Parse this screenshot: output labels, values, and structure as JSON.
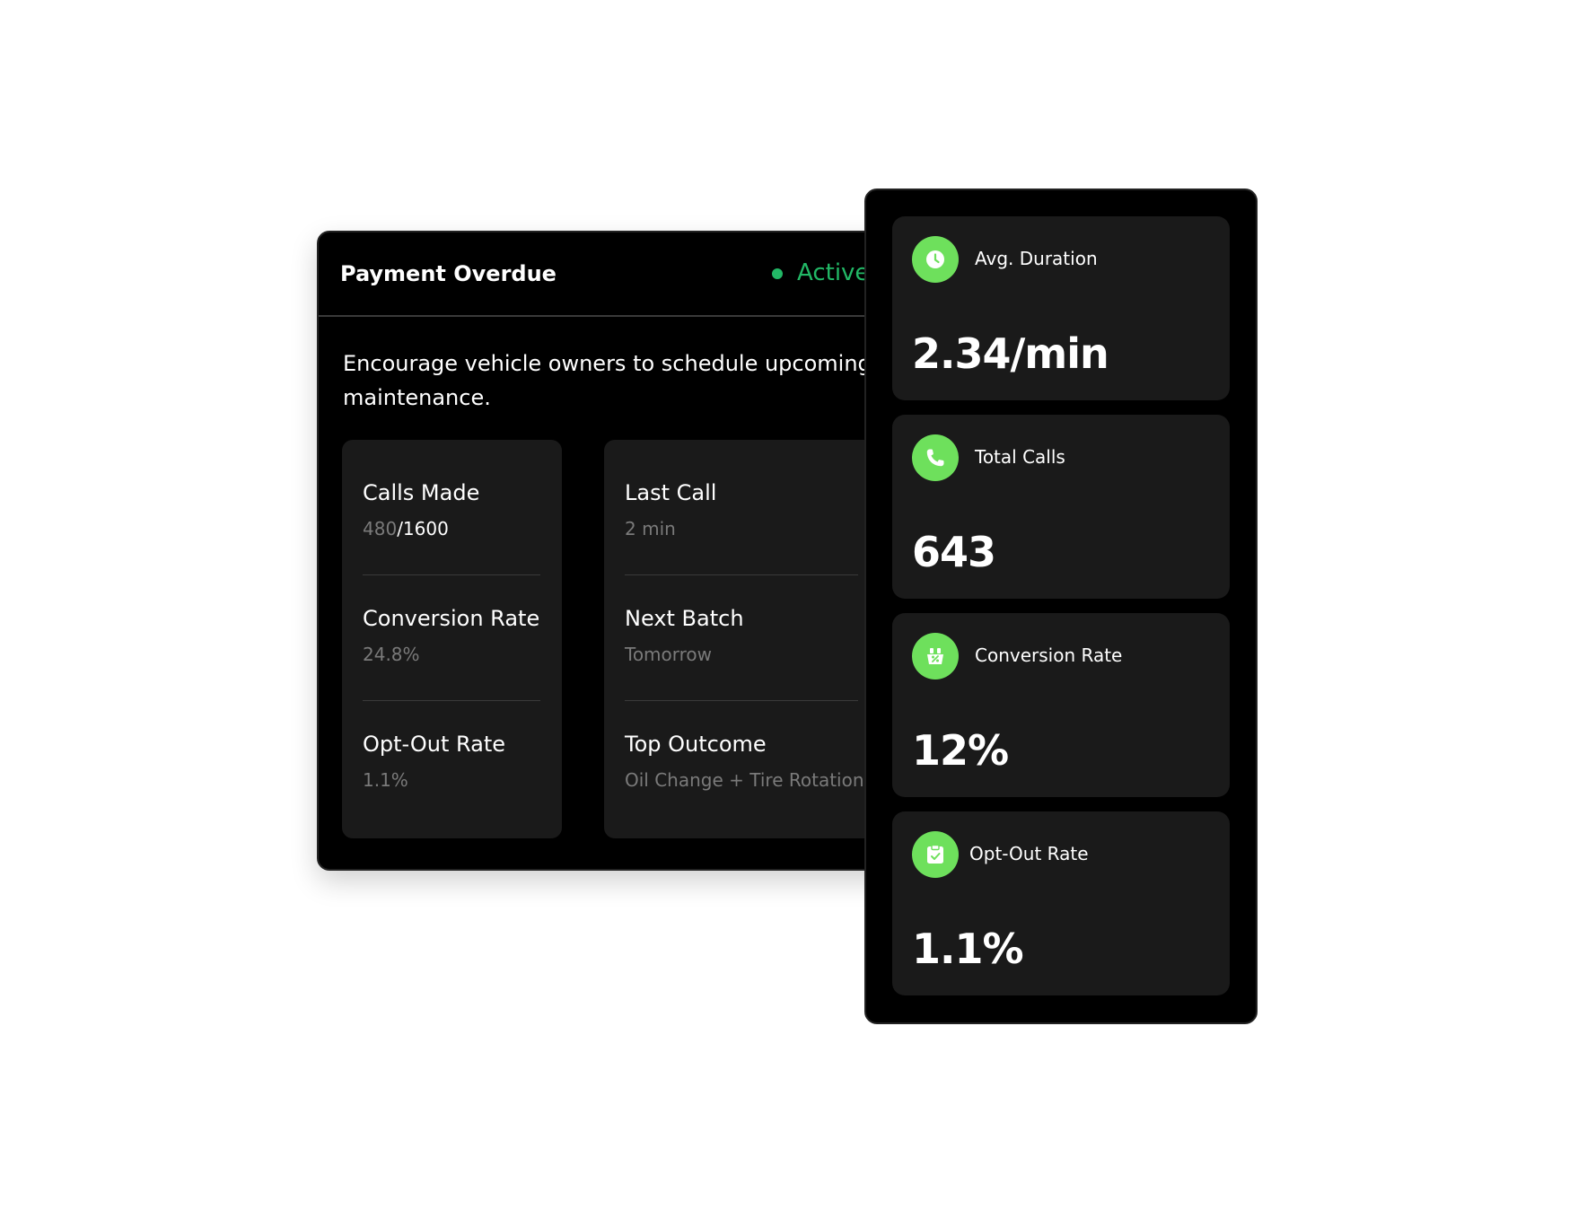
{
  "campaign": {
    "title": "Payment Overdue",
    "status": "Active",
    "description": "Encourage vehicle owners to schedule upcoming maintenance.",
    "stats_left": [
      {
        "label": "Calls Made",
        "value_done": "480",
        "value_total": "/1600"
      },
      {
        "label": "Conversion Rate",
        "value": "24.8%"
      },
      {
        "label": "Opt-Out Rate",
        "value": "1.1%"
      }
    ],
    "stats_right": [
      {
        "label": "Last Call",
        "value": "2 min"
      },
      {
        "label": "Next Batch",
        "value": "Tomorrow"
      },
      {
        "label": "Top Outcome",
        "value": "Oil Change + Tire Rotation"
      }
    ]
  },
  "metrics": [
    {
      "label": "Avg. Duration",
      "value": "2.34/min",
      "icon": "clock-icon"
    },
    {
      "label": "Total Calls",
      "value": "643",
      "icon": "phone-icon"
    },
    {
      "label": "Conversion Rate",
      "value": "12%",
      "icon": "conversion-icon"
    },
    {
      "label": "Opt-Out Rate",
      "value": "1.1%",
      "icon": "opt-out-icon"
    }
  ],
  "colors": {
    "accent_green": "#6ee05c",
    "status_green": "#22b866",
    "card_bg": "#000000",
    "tile_bg": "#1a1a1a"
  }
}
